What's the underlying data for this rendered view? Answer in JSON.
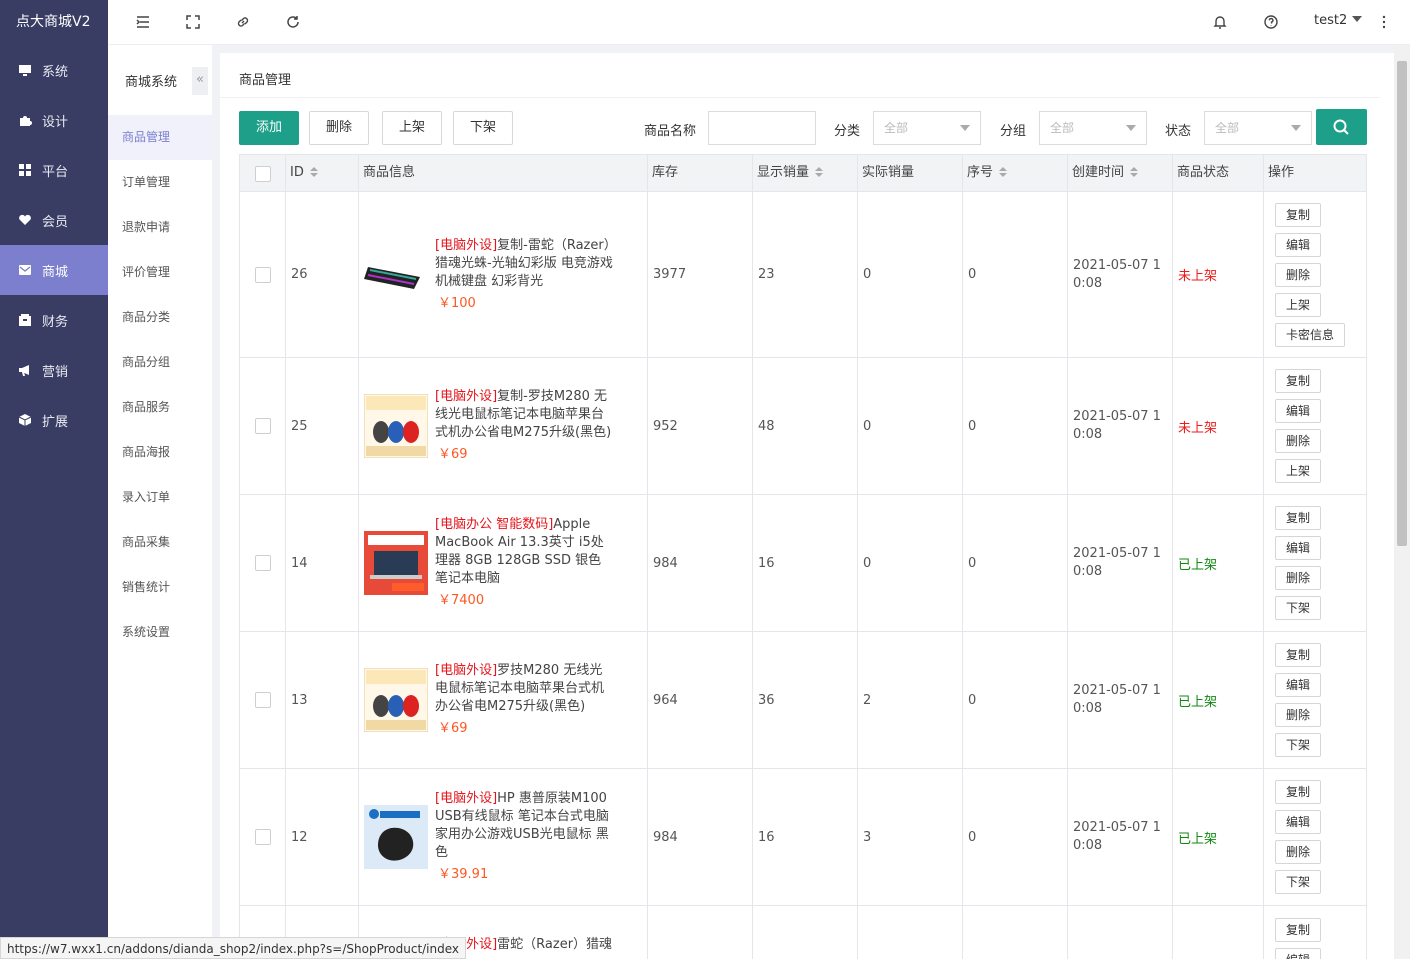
{
  "brand": "点大商城V2",
  "nav": [
    {
      "label": "系统",
      "icon": "monitor-icon"
    },
    {
      "label": "设计",
      "icon": "puzzle-icon"
    },
    {
      "label": "平台",
      "icon": "grid-icon"
    },
    {
      "label": "会员",
      "icon": "heart-icon"
    },
    {
      "label": "商城",
      "icon": "mail-icon",
      "active": true
    },
    {
      "label": "财务",
      "icon": "wallet-icon"
    },
    {
      "label": "营销",
      "icon": "megaphone-icon"
    },
    {
      "label": "扩展",
      "icon": "cube-icon"
    }
  ],
  "topbar": {
    "user": "test2"
  },
  "subnav": {
    "title": "商城系统",
    "collapse": "«",
    "items": [
      "商品管理",
      "订单管理",
      "退款申请",
      "评价管理",
      "商品分类",
      "商品分组",
      "商品服务",
      "商品海报",
      "录入订单",
      "商品采集",
      "销售统计",
      "系统设置"
    ]
  },
  "page": {
    "title": "商品管理",
    "buttons": {
      "add": "添加",
      "delete": "删除",
      "on_shelf": "上架",
      "off_shelf": "下架"
    },
    "filters": {
      "name_label": "商品名称",
      "category_label": "分类",
      "category_value": "全部",
      "group_label": "分组",
      "group_value": "全部",
      "status_label": "状态",
      "status_value": "全部"
    }
  },
  "table": {
    "headers": {
      "id": "ID",
      "info": "商品信息",
      "stock": "库存",
      "shown_sales": "显示销量",
      "real_sales": "实际销量",
      "seq": "序号",
      "created": "创建时间",
      "status": "商品状态",
      "ops": "操作"
    },
    "rows": [
      {
        "id": "26",
        "cat": "[电脑外设]",
        "name": "复制-雷蛇（Razer）猎魂光蛛-光轴幻彩版 电竞游戏机械键盘 幻彩背光",
        "price": "￥100",
        "stock": "3977",
        "shown": "23",
        "real": "0",
        "seq": "0",
        "created": "2021-05-07 10:08",
        "status": "未上架",
        "on": false,
        "ops": [
          "复制",
          "编辑",
          "删除",
          "上架",
          "卡密信息"
        ],
        "thumb": "keyboard"
      },
      {
        "id": "25",
        "cat": "[电脑外设]",
        "name": "复制-罗技M280 无线光电鼠标笔记本电脑苹果台式机办公省电M275升级(黑色)",
        "price": "￥69",
        "stock": "952",
        "shown": "48",
        "real": "0",
        "seq": "0",
        "created": "2021-05-07 10:08",
        "status": "未上架",
        "on": false,
        "ops": [
          "复制",
          "编辑",
          "删除",
          "上架"
        ],
        "thumb": "mice"
      },
      {
        "id": "14",
        "cat": "[电脑办公 智能数码]",
        "name": "Apple MacBook Air 13.3英寸 i5处理器 8GB 128GB SSD 银色 笔记本电脑",
        "price": "￥7400",
        "stock": "984",
        "shown": "16",
        "real": "0",
        "seq": "0",
        "created": "2021-05-07 10:08",
        "status": "已上架",
        "on": true,
        "ops": [
          "复制",
          "编辑",
          "删除",
          "下架"
        ],
        "thumb": "laptop"
      },
      {
        "id": "13",
        "cat": "[电脑外设]",
        "name": "罗技M280 无线光电鼠标笔记本电脑苹果台式机办公省电M275升级(黑色)",
        "price": "￥69",
        "stock": "964",
        "shown": "36",
        "real": "2",
        "seq": "0",
        "created": "2021-05-07 10:08",
        "status": "已上架",
        "on": true,
        "ops": [
          "复制",
          "编辑",
          "删除",
          "下架"
        ],
        "thumb": "mice"
      },
      {
        "id": "12",
        "cat": "[电脑外设]",
        "name": "HP 惠普原装M100 USB有线鼠标 笔记本台式电脑家用办公游戏USB光电鼠标 黑色",
        "price": "￥39.91",
        "stock": "984",
        "shown": "16",
        "real": "3",
        "seq": "0",
        "created": "2021-05-07 10:08",
        "status": "已上架",
        "on": true,
        "ops": [
          "复制",
          "编辑",
          "删除",
          "下架"
        ],
        "thumb": "hpmouse"
      },
      {
        "id": "",
        "cat": "[电脑外设]",
        "name": "雷蛇（Razer）猎魂",
        "price": "",
        "stock": "",
        "shown": "",
        "real": "",
        "seq": "",
        "created": "",
        "status": "",
        "on": false,
        "ops": [
          "复制",
          "编辑"
        ],
        "thumb": "none"
      }
    ]
  },
  "status_url": "https://w7.wxx1.cn/addons/dianda_shop2/index.php?s=/ShopProduct/index"
}
